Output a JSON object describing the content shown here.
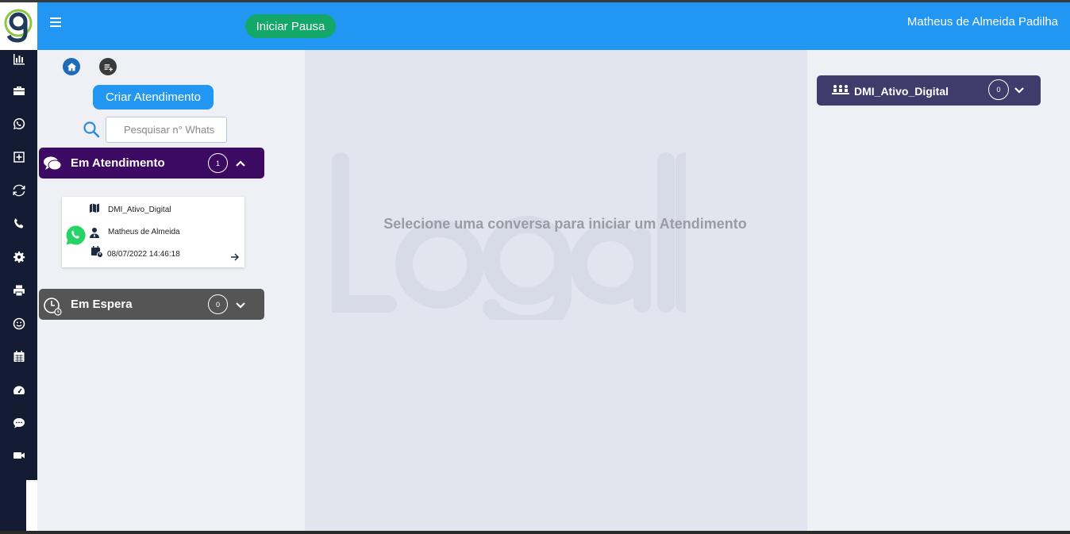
{
  "header": {
    "pause_label": "Iniciar Pausa",
    "user_name": "Matheus de Almeida Padilha"
  },
  "sidebar": {
    "items": [
      {
        "name": "reports",
        "icon": "bar-chart-icon"
      },
      {
        "name": "campaigns",
        "icon": "briefcase-icon"
      },
      {
        "name": "whatsapp",
        "icon": "whatsapp-icon"
      },
      {
        "name": "add",
        "icon": "plus-square-icon"
      },
      {
        "name": "refresh",
        "icon": "sync-icon"
      },
      {
        "name": "phone",
        "icon": "phone-icon"
      },
      {
        "name": "settings",
        "icon": "gear-icon"
      },
      {
        "name": "print",
        "icon": "printer-icon"
      },
      {
        "name": "emoji",
        "icon": "smile-icon"
      },
      {
        "name": "calendar",
        "icon": "calendar-icon"
      },
      {
        "name": "dashboard",
        "icon": "gauge-icon"
      },
      {
        "name": "chat",
        "icon": "chat-bubble-icon"
      },
      {
        "name": "video",
        "icon": "video-camera-icon"
      }
    ]
  },
  "left_panel": {
    "create_label": "Criar Atendimento",
    "search_placeholder": "Pesquisar n° Whats",
    "in_service": {
      "title": "Em Atendimento",
      "count": "1",
      "color": "#3d0a63"
    },
    "conversation": {
      "queue": "DMI_Ativo_Digital",
      "agent": "Matheus de Almeida",
      "datetime": "08/07/2022 14:46:18"
    },
    "waiting": {
      "title": "Em Espera",
      "count": "0",
      "color": "#555555"
    }
  },
  "center": {
    "message": "Selecione uma conversa para iniciar um Atendimento"
  },
  "right_panel": {
    "queue_title": "DMI_Ativo_Digital",
    "queue_count": "0",
    "color": "#3f3c6b"
  },
  "colors": {
    "header": "#2196f3",
    "sidebar": "#131c33",
    "pause_button": "#13a86a"
  }
}
